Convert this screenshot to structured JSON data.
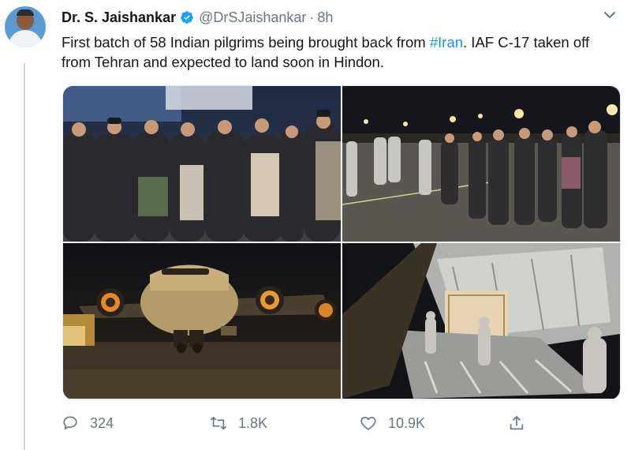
{
  "tweet": {
    "author_name": "Dr. S. Jaishankar",
    "handle": "@DrSJaishankar",
    "separator": "·",
    "time": "8h",
    "text_before": "First batch of 58 Indian pilgrims being brought back from ",
    "hashtag": "#Iran",
    "text_after": ". IAF C-17 taken off from Tehran and expected to land soon in Hindon."
  },
  "icons": {
    "verified": "verified-badge-icon",
    "menu": "chevron-down-icon",
    "reply": "reply-icon",
    "retweet": "retweet-icon",
    "like": "heart-icon",
    "share": "share-icon"
  },
  "actions": {
    "reply_count": "324",
    "retweet_count": "1.8K",
    "like_count": "10.9K"
  },
  "colors": {
    "link": "#1b95e0",
    "secondary_text": "#657786",
    "verified": "#1da1f2"
  }
}
